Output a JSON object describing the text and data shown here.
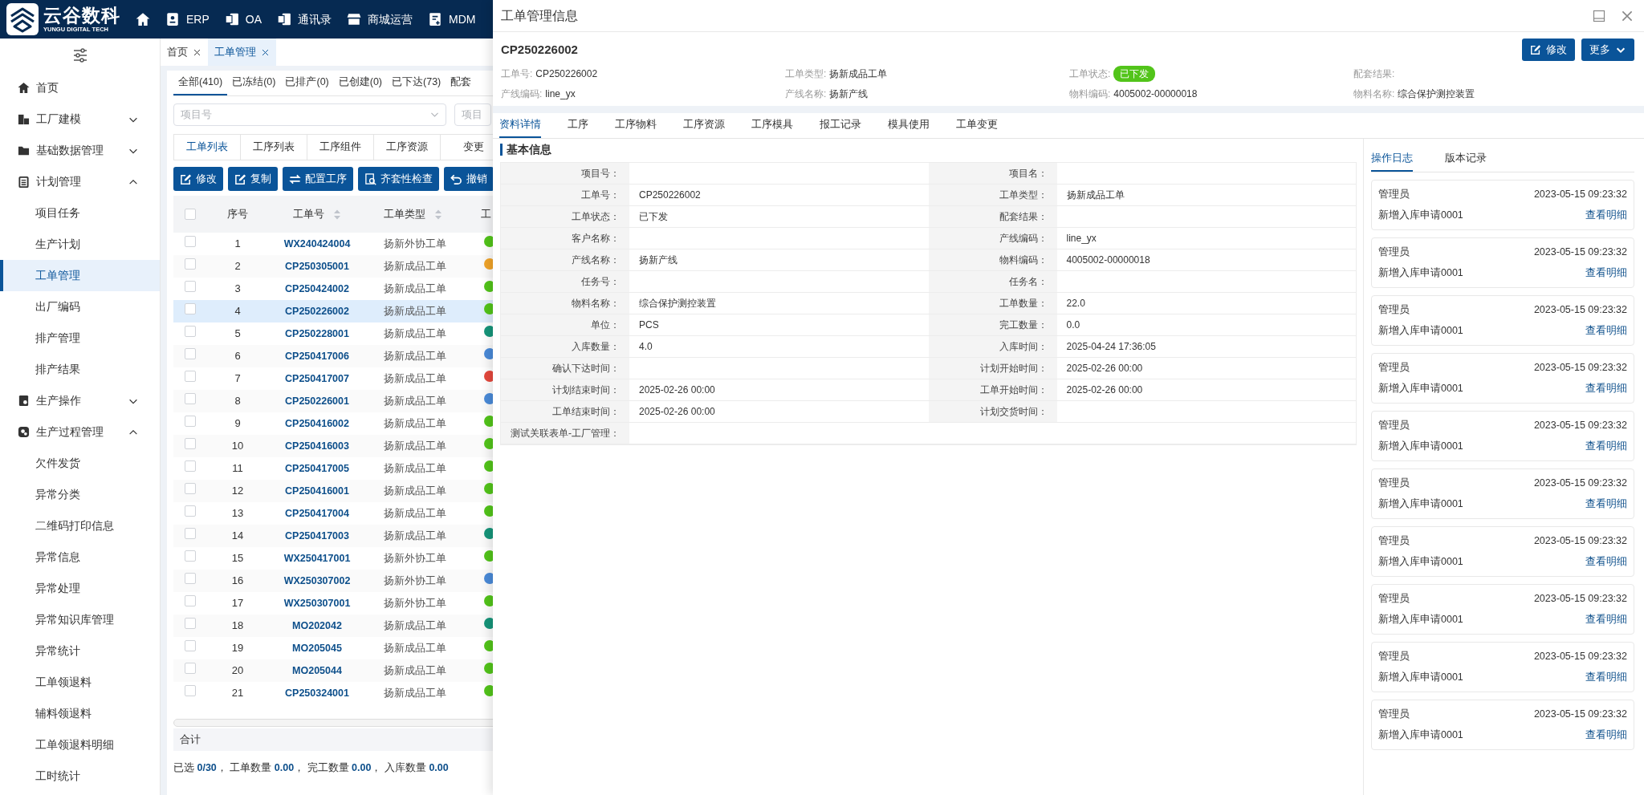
{
  "top_nav": {
    "logo": {
      "name": "云谷数科",
      "tagline": "YUNGU DIGITAL TECH"
    },
    "items": [
      {
        "label": "ERP"
      },
      {
        "label": "OA"
      },
      {
        "label": "通讯录"
      },
      {
        "label": "商城运营"
      },
      {
        "label": "MDM"
      }
    ]
  },
  "sidebar": {
    "items": [
      {
        "label": "首页",
        "selected": false
      },
      {
        "label": "工厂建模",
        "expanded": false,
        "selected": false
      },
      {
        "label": "基础数据管理",
        "expanded": false,
        "selected": false
      },
      {
        "label": "计划管理",
        "expanded": true,
        "selected": false,
        "children": [
          {
            "label": "项目任务",
            "selected": false
          },
          {
            "label": "生产计划",
            "selected": false
          },
          {
            "label": "工单管理",
            "selected": true
          },
          {
            "label": "出厂编码",
            "selected": false
          },
          {
            "label": "排产管理",
            "selected": false
          },
          {
            "label": "排产结果",
            "selected": false
          }
        ]
      },
      {
        "label": "生产操作",
        "expanded": false,
        "selected": false
      },
      {
        "label": "生产过程管理",
        "expanded": true,
        "selected": false,
        "children": [
          {
            "label": "欠件发货",
            "selected": false
          },
          {
            "label": "异常分类",
            "selected": false
          },
          {
            "label": "二维码打印信息",
            "selected": false
          },
          {
            "label": "异常信息",
            "selected": false
          },
          {
            "label": "异常处理",
            "selected": false
          },
          {
            "label": "异常知识库管理",
            "selected": false
          },
          {
            "label": "异常统计",
            "selected": false
          },
          {
            "label": "工单领退料",
            "selected": false
          },
          {
            "label": "辅料领退料",
            "selected": false
          },
          {
            "label": "工单领退料明细",
            "selected": false
          },
          {
            "label": "工时统计",
            "selected": false
          }
        ]
      }
    ]
  },
  "page_tabs": [
    {
      "label": "首页",
      "selected": false
    },
    {
      "label": "工单管理",
      "selected": true
    }
  ],
  "status_tabs": [
    {
      "label": "全部(410)",
      "selected": true
    },
    {
      "label": "已冻结(0)",
      "selected": false
    },
    {
      "label": "已排产(0)",
      "selected": false
    },
    {
      "label": "已创建(0)",
      "selected": false
    },
    {
      "label": "已下达(73)",
      "selected": false
    },
    {
      "label": "配套",
      "selected": false
    }
  ],
  "filters": [
    {
      "placeholder": "项目号"
    },
    {
      "placeholder": "项目"
    }
  ],
  "sub_tabs": [
    {
      "label": "工单列表",
      "selected": true
    },
    {
      "label": "工序列表",
      "selected": false
    },
    {
      "label": "工序组件",
      "selected": false
    },
    {
      "label": "工序资源",
      "selected": false
    },
    {
      "label": "变更",
      "selected": false
    }
  ],
  "toolbar": [
    {
      "label": "修改"
    },
    {
      "label": "复制"
    },
    {
      "label": "配置工序"
    },
    {
      "label": "齐套性检查"
    },
    {
      "label": "撤销"
    }
  ],
  "table": {
    "select_all_checked": false,
    "columns": [
      {
        "label": "序号",
        "sortable": false
      },
      {
        "label": "工单号",
        "sortable": true
      },
      {
        "label": "工单类型",
        "sortable": true
      },
      {
        "label": "工",
        "sortable": false
      }
    ],
    "rows": [
      {
        "no": "1",
        "order_no": "WX240424004",
        "type": "扬新外协工单",
        "color": "#52c41a",
        "checked": false,
        "selected": false
      },
      {
        "no": "2",
        "order_no": "CP250305001",
        "type": "扬新成品工单",
        "color": "#f0a429",
        "checked": false,
        "selected": false
      },
      {
        "no": "3",
        "order_no": "CP250424002",
        "type": "扬新成品工单",
        "color": "#52c41a",
        "checked": false,
        "selected": false
      },
      {
        "no": "4",
        "order_no": "CP250226002",
        "type": "扬新成品工单",
        "color": "#52c41a",
        "checked": false,
        "selected": true
      },
      {
        "no": "5",
        "order_no": "CP250228001",
        "type": "扬新成品工单",
        "color": "#16957a",
        "checked": false,
        "selected": false
      },
      {
        "no": "6",
        "order_no": "CP250417006",
        "type": "扬新成品工单",
        "color": "#4a8ad8",
        "checked": false,
        "selected": false
      },
      {
        "no": "7",
        "order_no": "CP250417007",
        "type": "扬新成品工单",
        "color": "#e5483d",
        "checked": false,
        "selected": false
      },
      {
        "no": "8",
        "order_no": "CP250226001",
        "type": "扬新成品工单",
        "color": "#4a8ad8",
        "checked": false,
        "selected": false
      },
      {
        "no": "9",
        "order_no": "CP250416002",
        "type": "扬新成品工单",
        "color": "#52c41a",
        "checked": false,
        "selected": false
      },
      {
        "no": "10",
        "order_no": "CP250416003",
        "type": "扬新成品工单",
        "color": "#52c41a",
        "checked": false,
        "selected": false
      },
      {
        "no": "11",
        "order_no": "CP250417005",
        "type": "扬新成品工单",
        "color": "#52c41a",
        "checked": false,
        "selected": false
      },
      {
        "no": "12",
        "order_no": "CP250416001",
        "type": "扬新成品工单",
        "color": "#52c41a",
        "checked": false,
        "selected": false
      },
      {
        "no": "13",
        "order_no": "CP250417004",
        "type": "扬新成品工单",
        "color": "#52c41a",
        "checked": false,
        "selected": false
      },
      {
        "no": "14",
        "order_no": "CP250417003",
        "type": "扬新成品工单",
        "color": "#16957a",
        "checked": false,
        "selected": false
      },
      {
        "no": "15",
        "order_no": "WX250417001",
        "type": "扬新外协工单",
        "color": "#52c41a",
        "checked": false,
        "selected": false
      },
      {
        "no": "16",
        "order_no": "WX250307002",
        "type": "扬新外协工单",
        "color": "#4a8ad8",
        "checked": false,
        "selected": false
      },
      {
        "no": "17",
        "order_no": "WX250307001",
        "type": "扬新外协工单",
        "color": "#52c41a",
        "checked": false,
        "selected": false
      },
      {
        "no": "18",
        "order_no": "MO202042",
        "type": "扬新成品工单",
        "color": "#16957a",
        "checked": false,
        "selected": false
      },
      {
        "no": "19",
        "order_no": "MO205045",
        "type": "扬新成品工单",
        "color": "#52c41a",
        "checked": false,
        "selected": false
      },
      {
        "no": "20",
        "order_no": "MO205044",
        "type": "扬新成品工单",
        "color": "#52c41a",
        "checked": false,
        "selected": false
      },
      {
        "no": "21",
        "order_no": "CP250324001",
        "type": "扬新成品工单",
        "color": "#52c41a",
        "checked": false,
        "selected": false
      }
    ],
    "total_label": "合计"
  },
  "summary": "已选 **0/30**， 工单数量 **0.00**， 完工数量 **0.00**， 入库数量 **0.00**",
  "drawer": {
    "title": "工单管理信息",
    "record_no": "CP250226002",
    "buttons": [
      {
        "label": "修改"
      },
      {
        "label": "更多"
      }
    ],
    "fields": [
      {
        "label": "工单号:",
        "value": "CP250226002",
        "kind": "text"
      },
      {
        "label": "工单类型:",
        "value": "扬新成品工单",
        "kind": "text"
      },
      {
        "label": "工单状态:",
        "value": "已下发",
        "kind": "badge"
      },
      {
        "label": "配套结果:"
      },
      {
        "label": "产线编码:",
        "value": "line_yx",
        "kind": "text"
      },
      {
        "label": "产线名称:",
        "value": "扬新产线",
        "kind": "text"
      },
      {
        "label": "物料编码:",
        "value": "4005002-00000018",
        "kind": "text"
      },
      {
        "label": "物料名称:",
        "value": "综合保护测控装置",
        "kind": "text"
      }
    ],
    "tabs": [
      {
        "label": "资料详情",
        "selected": true
      },
      {
        "label": "工序",
        "selected": false
      },
      {
        "label": "工序物料",
        "selected": false
      },
      {
        "label": "工序资源",
        "selected": false
      },
      {
        "label": "工序模具",
        "selected": false
      },
      {
        "label": "报工记录",
        "selected": false
      },
      {
        "label": "模具使用",
        "selected": false
      },
      {
        "label": "工单变更",
        "selected": false
      }
    ],
    "section_title": "基本信息",
    "details": [
      {
        "label": "项目号："
      },
      {
        "label": "项目名："
      },
      {
        "label": "工单号：",
        "value": "CP250226002"
      },
      {
        "label": "工单类型：",
        "value": "扬新成品工单"
      },
      {
        "label": "工单状态：",
        "value": "已下发"
      },
      {
        "label": "配套结果："
      },
      {
        "label": "客户名称："
      },
      {
        "label": "产线编码：",
        "value": "line_yx"
      },
      {
        "label": "产线名称：",
        "value": "扬新产线"
      },
      {
        "label": "物料编码：",
        "value": "4005002-00000018"
      },
      {
        "label": "任务号："
      },
      {
        "label": "任务名："
      },
      {
        "label": "物料名称：",
        "value": "综合保护测控装置"
      },
      {
        "label": "工单数量：",
        "value": "22.0"
      },
      {
        "label": "单位：",
        "value": "PCS"
      },
      {
        "label": "完工数量：",
        "value": "0.0"
      },
      {
        "label": "入库数量：",
        "value": "4.0"
      },
      {
        "label": "入库时间：",
        "value": "2025-04-24 17:36:05"
      },
      {
        "label": "确认下达时间："
      },
      {
        "label": "计划开始时间：",
        "value": "2025-02-26 00:00"
      },
      {
        "label": "计划结束时间：",
        "value": "2025-02-26 00:00"
      },
      {
        "label": "工单开始时间：",
        "value": "2025-02-26 00:00"
      },
      {
        "label": "工单结束时间：",
        "value": "2025-02-26 00:00"
      },
      {
        "label": "计划交货时间："
      },
      {
        "label": "测试关联表单-工厂管理："
      }
    ],
    "log_tabs": [
      {
        "label": "操作日志",
        "selected": true
      },
      {
        "label": "版本记录",
        "selected": false
      }
    ],
    "log": [
      {
        "user": "管理员",
        "time": "2023-05-15 09:23:32",
        "action": "新增入库申请0001",
        "link": "查看明细"
      },
      {
        "user": "管理员",
        "time": "2023-05-15 09:23:32",
        "action": "新增入库申请0001",
        "link": "查看明细"
      },
      {
        "user": "管理员",
        "time": "2023-05-15 09:23:32",
        "action": "新增入库申请0001",
        "link": "查看明细"
      },
      {
        "user": "管理员",
        "time": "2023-05-15 09:23:32",
        "action": "新增入库申请0001",
        "link": "查看明细"
      },
      {
        "user": "管理员",
        "time": "2023-05-15 09:23:32",
        "action": "新增入库申请0001",
        "link": "查看明细"
      },
      {
        "user": "管理员",
        "time": "2023-05-15 09:23:32",
        "action": "新增入库申请0001",
        "link": "查看明细"
      },
      {
        "user": "管理员",
        "time": "2023-05-15 09:23:32",
        "action": "新增入库申请0001",
        "link": "查看明细"
      },
      {
        "user": "管理员",
        "time": "2023-05-15 09:23:32",
        "action": "新增入库申请0001",
        "link": "查看明细"
      },
      {
        "user": "管理员",
        "time": "2023-05-15 09:23:32",
        "action": "新增入库申请0001",
        "link": "查看明细"
      },
      {
        "user": "管理员",
        "time": "2023-05-15 09:23:32",
        "action": "新增入库申请0001",
        "link": "查看明细"
      }
    ]
  }
}
